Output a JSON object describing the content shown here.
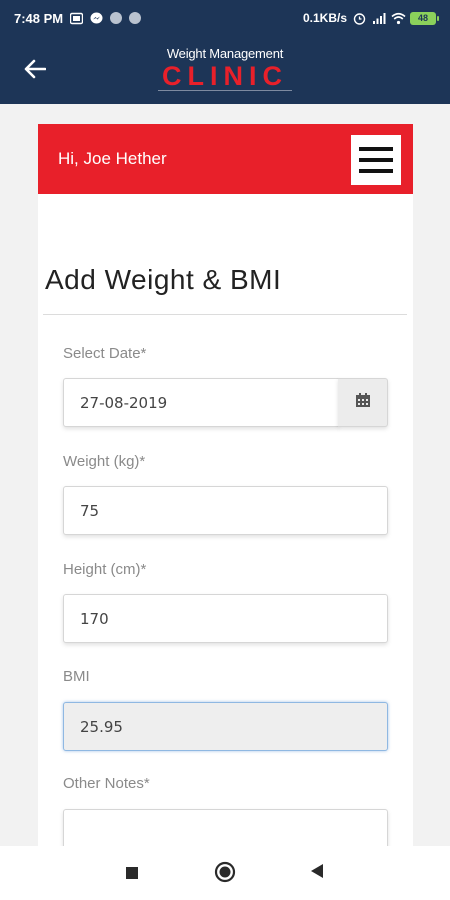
{
  "status_bar": {
    "time": "7:48 PM",
    "network_speed": "0.1KB/s",
    "battery": "48"
  },
  "header": {
    "logo_top": "Weight Management",
    "logo_bottom": "CLINIC"
  },
  "greeting": "Hi, Joe Hether",
  "form": {
    "title": "Add Weight & BMI",
    "date_label": "Select Date*",
    "date_value": "27-08-2019",
    "weight_label": "Weight (kg)*",
    "weight_value": "75",
    "height_label": "Height (cm)*",
    "height_value": "170",
    "bmi_label": "BMI",
    "bmi_value": "25.95",
    "notes_label": "Other Notes*",
    "notes_value": ""
  },
  "colors": {
    "header_bg": "#1d3557",
    "accent_red": "#e8202a",
    "battery_green": "#8bd15b"
  }
}
